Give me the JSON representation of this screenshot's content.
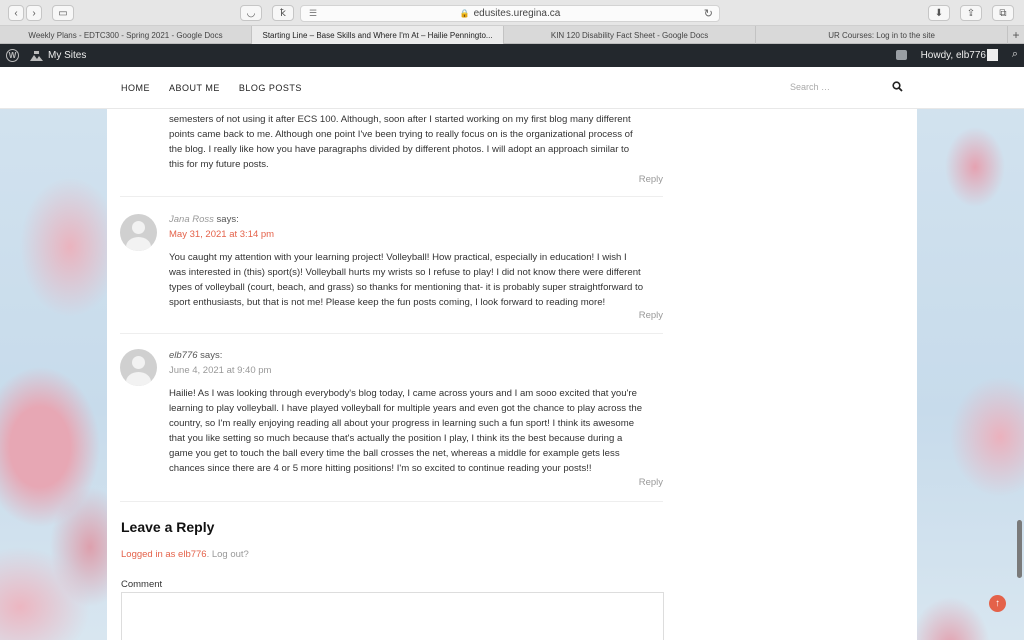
{
  "browser": {
    "url": "edusites.uregina.ca",
    "tabs": [
      {
        "label": "Weekly Plans - EDTC300 - Spring 2021 - Google Docs"
      },
      {
        "label": "Starting Line – Base Skills and Where I'm At – Hailie Penningto..."
      },
      {
        "label": "KIN 120 Disability Fact Sheet - Google Docs"
      },
      {
        "label": "UR Courses: Log in to the site"
      }
    ],
    "new_tab": "+"
  },
  "adminbar": {
    "my_sites": "My Sites",
    "howdy": "Howdy, elb776"
  },
  "nav": {
    "items": [
      "HOME",
      "ABOUT ME",
      "BLOG POSTS"
    ],
    "search_placeholder": "Search …"
  },
  "comments": {
    "first_partial": {
      "lines": [
        "semesters of not using it after ECS 100. Although, soon after I started working on my first blog many different",
        "points came back to me. Although one point I've been trying to really focus on is the organizational process of",
        "the blog. I really like how you have paragraphs divided by different photos. I will adopt an approach similar to",
        "this for my future posts."
      ],
      "reply": "Reply"
    },
    "second": {
      "author": "Jana Ross",
      "says": "says:",
      "date": "May 31, 2021 at 3:14 pm",
      "lines": [
        "You caught my attention with your learning project! Volleyball! How practical, especially in education! I wish I",
        "was interested in (this) sport(s)! Volleyball hurts my wrists so I refuse to play! I did not know there were different",
        "types of volleyball (court, beach, and grass) so thanks for mentioning that- it is probably super straightforward to",
        "sport enthusiasts, but that is not me! Please keep the fun posts coming, I look forward to reading more!"
      ],
      "reply": "Reply"
    },
    "third": {
      "author": "elb776",
      "says": "says:",
      "date": "June 4, 2021 at 9:40 pm",
      "lines": [
        "Hailie! As I was looking through everybody's blog today, I came across yours and I am sooo excited that you're",
        "learning to play volleyball. I have played volleyball for multiple years and even got the chance to play across the",
        "country, so I'm really enjoying reading all about your progress in learning such a fun sport! I think its awesome",
        "that you like setting so much because that's actually the position I play, I think its the best because during a",
        "game you get to touch the ball every time the ball crosses the net, whereas a middle for example gets less",
        "chances since there are 4 or 5 more hitting positions! I'm so excited to continue reading your posts!!"
      ],
      "reply": "Reply"
    }
  },
  "reply_form": {
    "heading": "Leave a Reply",
    "logged_in": "Logged in as elb776",
    "log_out": "Log out?",
    "comment_label": "Comment"
  },
  "colors": {
    "accent": "#e4624a",
    "adminbar": "#23282d"
  }
}
